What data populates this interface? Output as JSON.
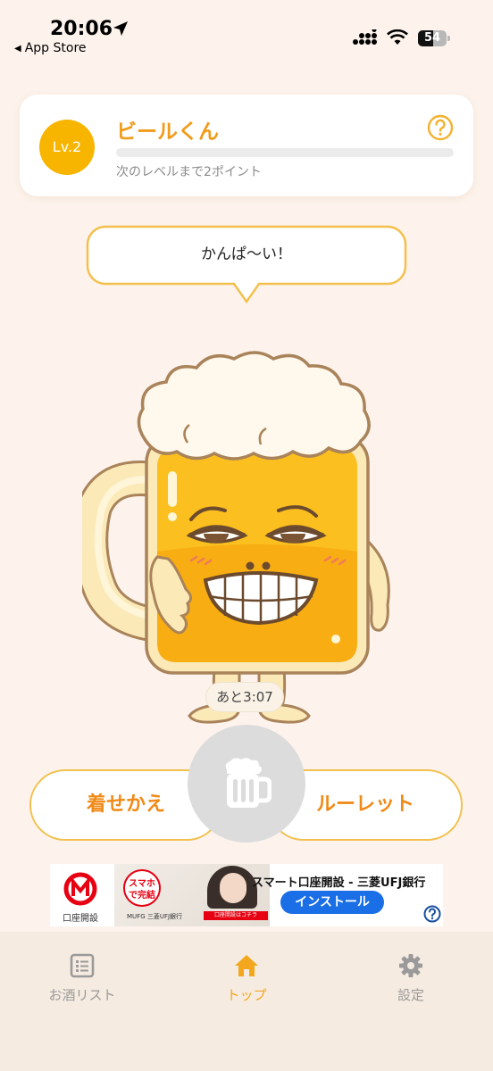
{
  "status_bar": {
    "time": "20:06",
    "back_label": "App Store",
    "battery_level": "54",
    "icons": [
      "location-arrow-icon",
      "cellular-signal-icon",
      "wifi-icon",
      "battery-icon"
    ]
  },
  "level_card": {
    "level": "Lv.2",
    "name": "ビールくん",
    "progress_fraction": 0.0,
    "next_level_text": "次のレベルまで2ポイント",
    "help_icon": "question-circle-icon"
  },
  "speech": {
    "text": "かんぱ〜い！"
  },
  "character": {
    "icon": "beer-mug-character"
  },
  "timer": {
    "text": "あと3:07"
  },
  "actions": {
    "dressup_label": "着せかえ",
    "roulette_label": "ルーレット",
    "drink_icon": "beer-mug-icon"
  },
  "ad": {
    "logo_text": "口座開設",
    "badge_text": "スマホで完結",
    "bank_small": "MUFG 三菱UFJ銀行",
    "cta_small": "口座開設はコチラ",
    "headline": "スマート口座開設 - 三菱UFJ銀行",
    "install_label": "インストール",
    "info_icon": "question-circle-icon"
  },
  "tabs": [
    {
      "label": "お酒リスト",
      "icon": "list-icon",
      "active": false
    },
    {
      "label": "トップ",
      "icon": "home-icon",
      "active": true
    },
    {
      "label": "設定",
      "icon": "gear-icon",
      "active": false
    }
  ],
  "colors": {
    "background": "#fdf3ec",
    "accent": "#f7b500",
    "accent_text": "#f08a17",
    "tab_bar": "#f6ebe0",
    "install_button": "#1a6ee6"
  }
}
